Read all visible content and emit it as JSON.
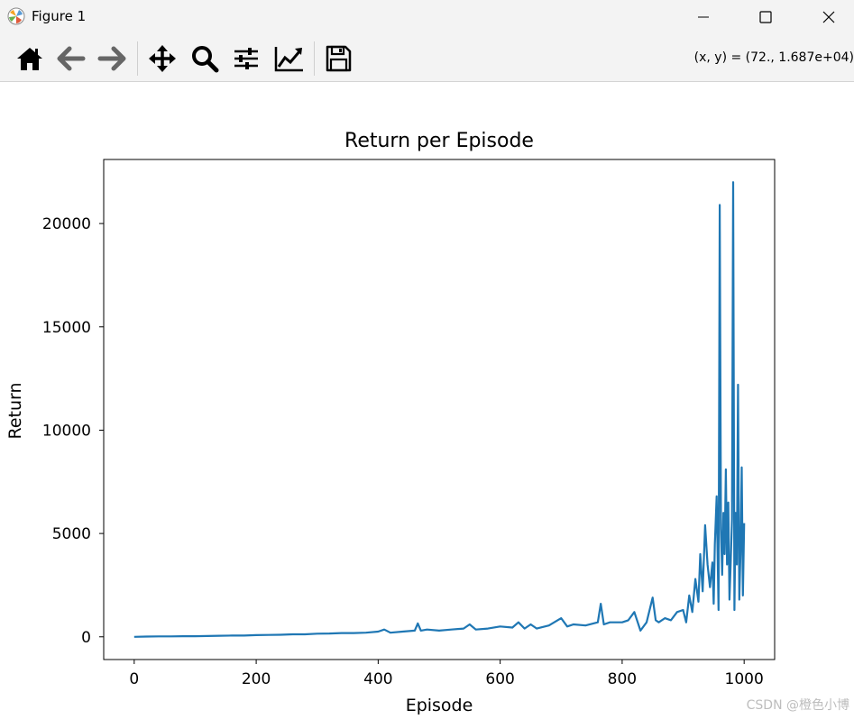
{
  "window": {
    "title": "Figure 1",
    "icon": "matplotlib-icon",
    "controls": {
      "minimize": "minimize-icon",
      "maximize": "maximize-icon",
      "close": "close-icon"
    }
  },
  "toolbar": {
    "tools": [
      {
        "name": "home",
        "icon": "home-icon"
      },
      {
        "name": "back",
        "icon": "arrow-left-icon"
      },
      {
        "name": "forward",
        "icon": "arrow-right-icon"
      },
      {
        "name": "pan",
        "icon": "move-icon"
      },
      {
        "name": "zoom",
        "icon": "magnifier-icon"
      },
      {
        "name": "configure-subplots",
        "icon": "sliders-icon"
      },
      {
        "name": "edit-axis",
        "icon": "line-chart-icon"
      },
      {
        "name": "save",
        "icon": "floppy-disk-icon"
      }
    ],
    "coordinates": "(x, y) = (72., 1.687e+04)"
  },
  "watermark": "CSDN @橙色小博",
  "chart_data": {
    "type": "line",
    "title": "Return per Episode",
    "xlabel": "Episode",
    "ylabel": "Return",
    "xlim": [
      -50,
      1050
    ],
    "ylim": [
      -1100,
      23100
    ],
    "xticks": [
      0,
      200,
      400,
      600,
      800,
      1000
    ],
    "yticks": [
      0,
      5000,
      10000,
      15000,
      20000
    ],
    "grid": false,
    "color": "#1f77b4",
    "series": [
      {
        "x": [
          0,
          20,
          40,
          60,
          80,
          100,
          120,
          140,
          160,
          180,
          200,
          220,
          240,
          260,
          280,
          300,
          320,
          340,
          360,
          380,
          400,
          410,
          420,
          440,
          460,
          465,
          470,
          480,
          500,
          520,
          540,
          550,
          560,
          580,
          600,
          620,
          630,
          640,
          650,
          660,
          680,
          700,
          710,
          720,
          740,
          760,
          765,
          770,
          780,
          800,
          810,
          820,
          830,
          840,
          850,
          855,
          860,
          870,
          880,
          890,
          900,
          905,
          910,
          915,
          920,
          925,
          928,
          932,
          936,
          940,
          944,
          948,
          950,
          952,
          955,
          958,
          960,
          962,
          964,
          966,
          968,
          970,
          972,
          974,
          976,
          978,
          980,
          982,
          984,
          986,
          988,
          990,
          992,
          994,
          996,
          998,
          1000
        ],
        "y": [
          0,
          10,
          20,
          20,
          30,
          30,
          40,
          50,
          60,
          60,
          80,
          90,
          100,
          120,
          120,
          150,
          160,
          180,
          180,
          200,
          250,
          350,
          200,
          250,
          300,
          650,
          300,
          350,
          300,
          350,
          400,
          600,
          350,
          400,
          500,
          450,
          700,
          400,
          600,
          400,
          550,
          900,
          500,
          600,
          550,
          700,
          1600,
          600,
          700,
          700,
          800,
          1200,
          300,
          700,
          1900,
          800,
          700,
          900,
          800,
          1200,
          1300,
          700,
          2000,
          1200,
          2800,
          1700,
          4000,
          2200,
          5400,
          3500,
          2400,
          3600,
          1600,
          4500,
          6800,
          1300,
          20900,
          5200,
          3000,
          6000,
          4000,
          8100,
          3500,
          6500,
          1800,
          3600,
          5700,
          22000,
          1300,
          6000,
          3500,
          12200,
          1800,
          4000,
          8200,
          2000,
          5500
        ]
      }
    ]
  }
}
